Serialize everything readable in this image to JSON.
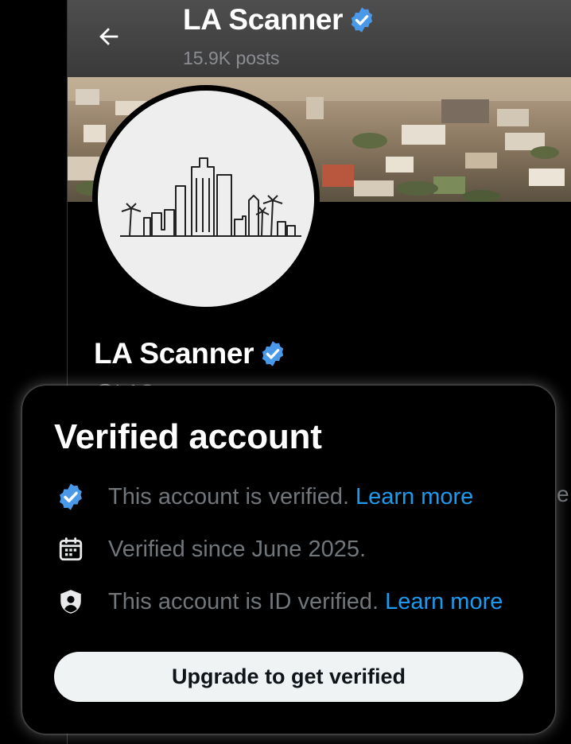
{
  "header": {
    "title": "LA Scanner",
    "posts_count": "15.9K posts"
  },
  "profile": {
    "name": "LA Scanner",
    "handle_peek": "@LAS"
  },
  "card": {
    "title": "Verified account",
    "rows": [
      {
        "icon": "verified-badge-icon",
        "text": "This account is verified.",
        "link": "Learn more"
      },
      {
        "icon": "calendar-icon",
        "text": "Verified since June 2025.",
        "link": ""
      },
      {
        "icon": "id-shield-icon",
        "text": "This account is ID verified.",
        "link": "Learn more"
      }
    ],
    "button_label": "Upgrade to get verified"
  },
  "edge_text": "e",
  "colors": {
    "accent_blue": "#1d9bf0",
    "badge_blue": "#4a99e9",
    "muted_text": "#71767b",
    "header_bg": "#444444",
    "button_bg": "#eff3f4"
  }
}
